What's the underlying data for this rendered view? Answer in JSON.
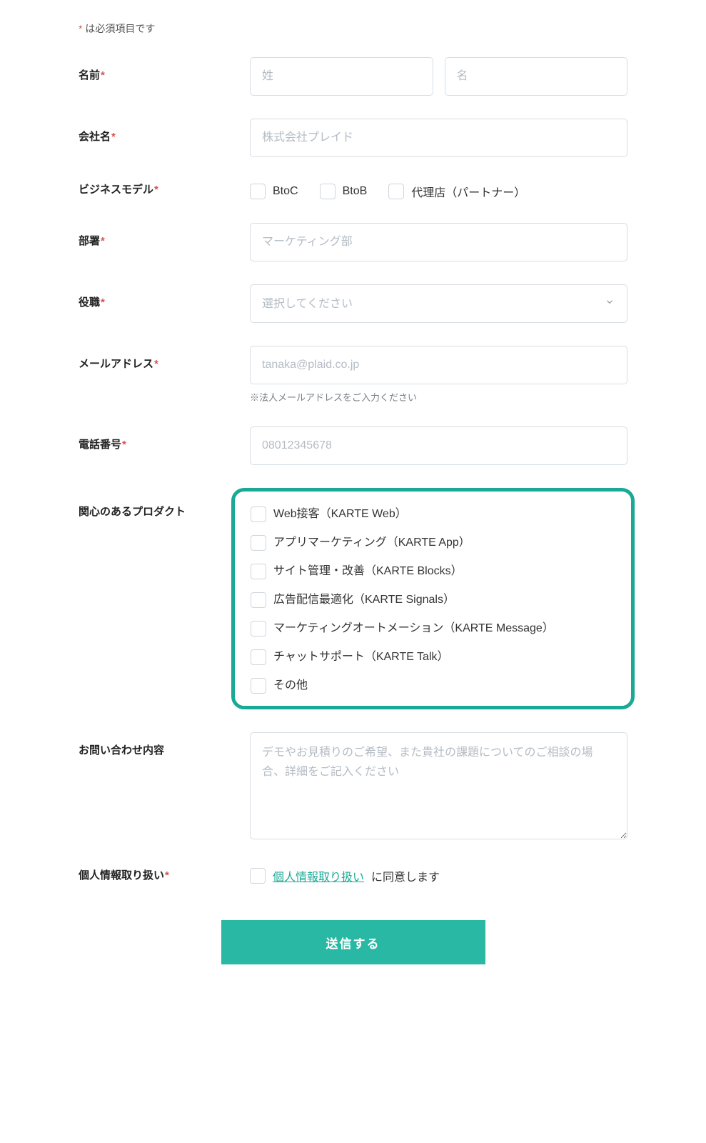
{
  "requiredNote": {
    "asterisk": "*",
    "text": " は必須項目です"
  },
  "name": {
    "label": "名前",
    "lastPlaceholder": "姓",
    "firstPlaceholder": "名"
  },
  "company": {
    "label": "会社名",
    "placeholder": "株式会社プレイド"
  },
  "businessModel": {
    "label": "ビジネスモデル",
    "options": {
      "btoc": "BtoC",
      "btob": "BtoB",
      "partner": "代理店（パートナー）"
    }
  },
  "department": {
    "label": "部署",
    "placeholder": "マーケティング部"
  },
  "position": {
    "label": "役職",
    "placeholder": "選択してください"
  },
  "email": {
    "label": "メールアドレス",
    "placeholder": "tanaka@plaid.co.jp",
    "hint": "※法人メールアドレスをご入力ください"
  },
  "phone": {
    "label": "電話番号",
    "placeholder": "08012345678"
  },
  "products": {
    "label": "関心のあるプロダクト",
    "items": {
      "web": "Web接客（KARTE Web）",
      "app": "アプリマーケティング（KARTE App）",
      "blocks": "サイト管理・改善（KARTE Blocks）",
      "signals": "広告配信最適化（KARTE Signals）",
      "message": "マーケティングオートメーション（KARTE Message）",
      "talk": "チャットサポート（KARTE Talk）",
      "other": "その他"
    }
  },
  "inquiry": {
    "label": "お問い合わせ内容",
    "placeholder": "デモやお見積りのご希望、また貴社の課題についてのご相談の場合、詳細をご記入ください"
  },
  "privacy": {
    "label": "個人情報取り扱い",
    "linkText": "個人情報取り扱い",
    "suffix": " に同意します"
  },
  "submit": {
    "label": "送信する"
  }
}
